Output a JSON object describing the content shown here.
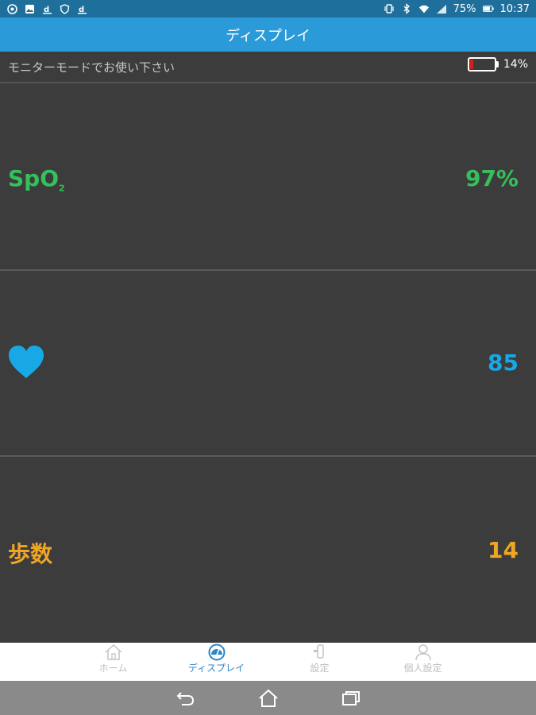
{
  "status_bar": {
    "battery_percent": "75%",
    "time": "10:37",
    "left_icons": [
      "chrome-icon",
      "image-icon",
      "d-icon",
      "shield-icon",
      "d-icon"
    ],
    "right_icons": [
      "vibrate-icon",
      "bluetooth-icon",
      "wifi-icon",
      "signal-icon",
      "battery-icon"
    ]
  },
  "header": {
    "title": "ディスプレイ"
  },
  "notice": {
    "text": "モニターモードでお使い下さい",
    "device_battery": "14%",
    "device_battery_level": 0.14,
    "device_battery_color": "#d11f1f"
  },
  "metrics": {
    "spo2": {
      "label": "SpO",
      "subscript": "2",
      "value": "97%",
      "color": "#34c05a"
    },
    "heart_rate": {
      "icon": "heart-icon",
      "value": "85",
      "color": "#18a8e6"
    },
    "steps": {
      "label": "歩数",
      "value": "14",
      "color": "#f0a524"
    }
  },
  "bottom_nav": {
    "items": [
      {
        "label": "ホーム",
        "icon": "home-icon",
        "active": false
      },
      {
        "label": "ディスプレイ",
        "icon": "gauge-icon",
        "active": true
      },
      {
        "label": "設定",
        "icon": "device-settings-icon",
        "active": false
      },
      {
        "label": "個人設定",
        "icon": "person-icon",
        "active": false
      }
    ]
  },
  "system_nav": {
    "icons": [
      "back-icon",
      "home-icon",
      "recents-icon"
    ]
  }
}
